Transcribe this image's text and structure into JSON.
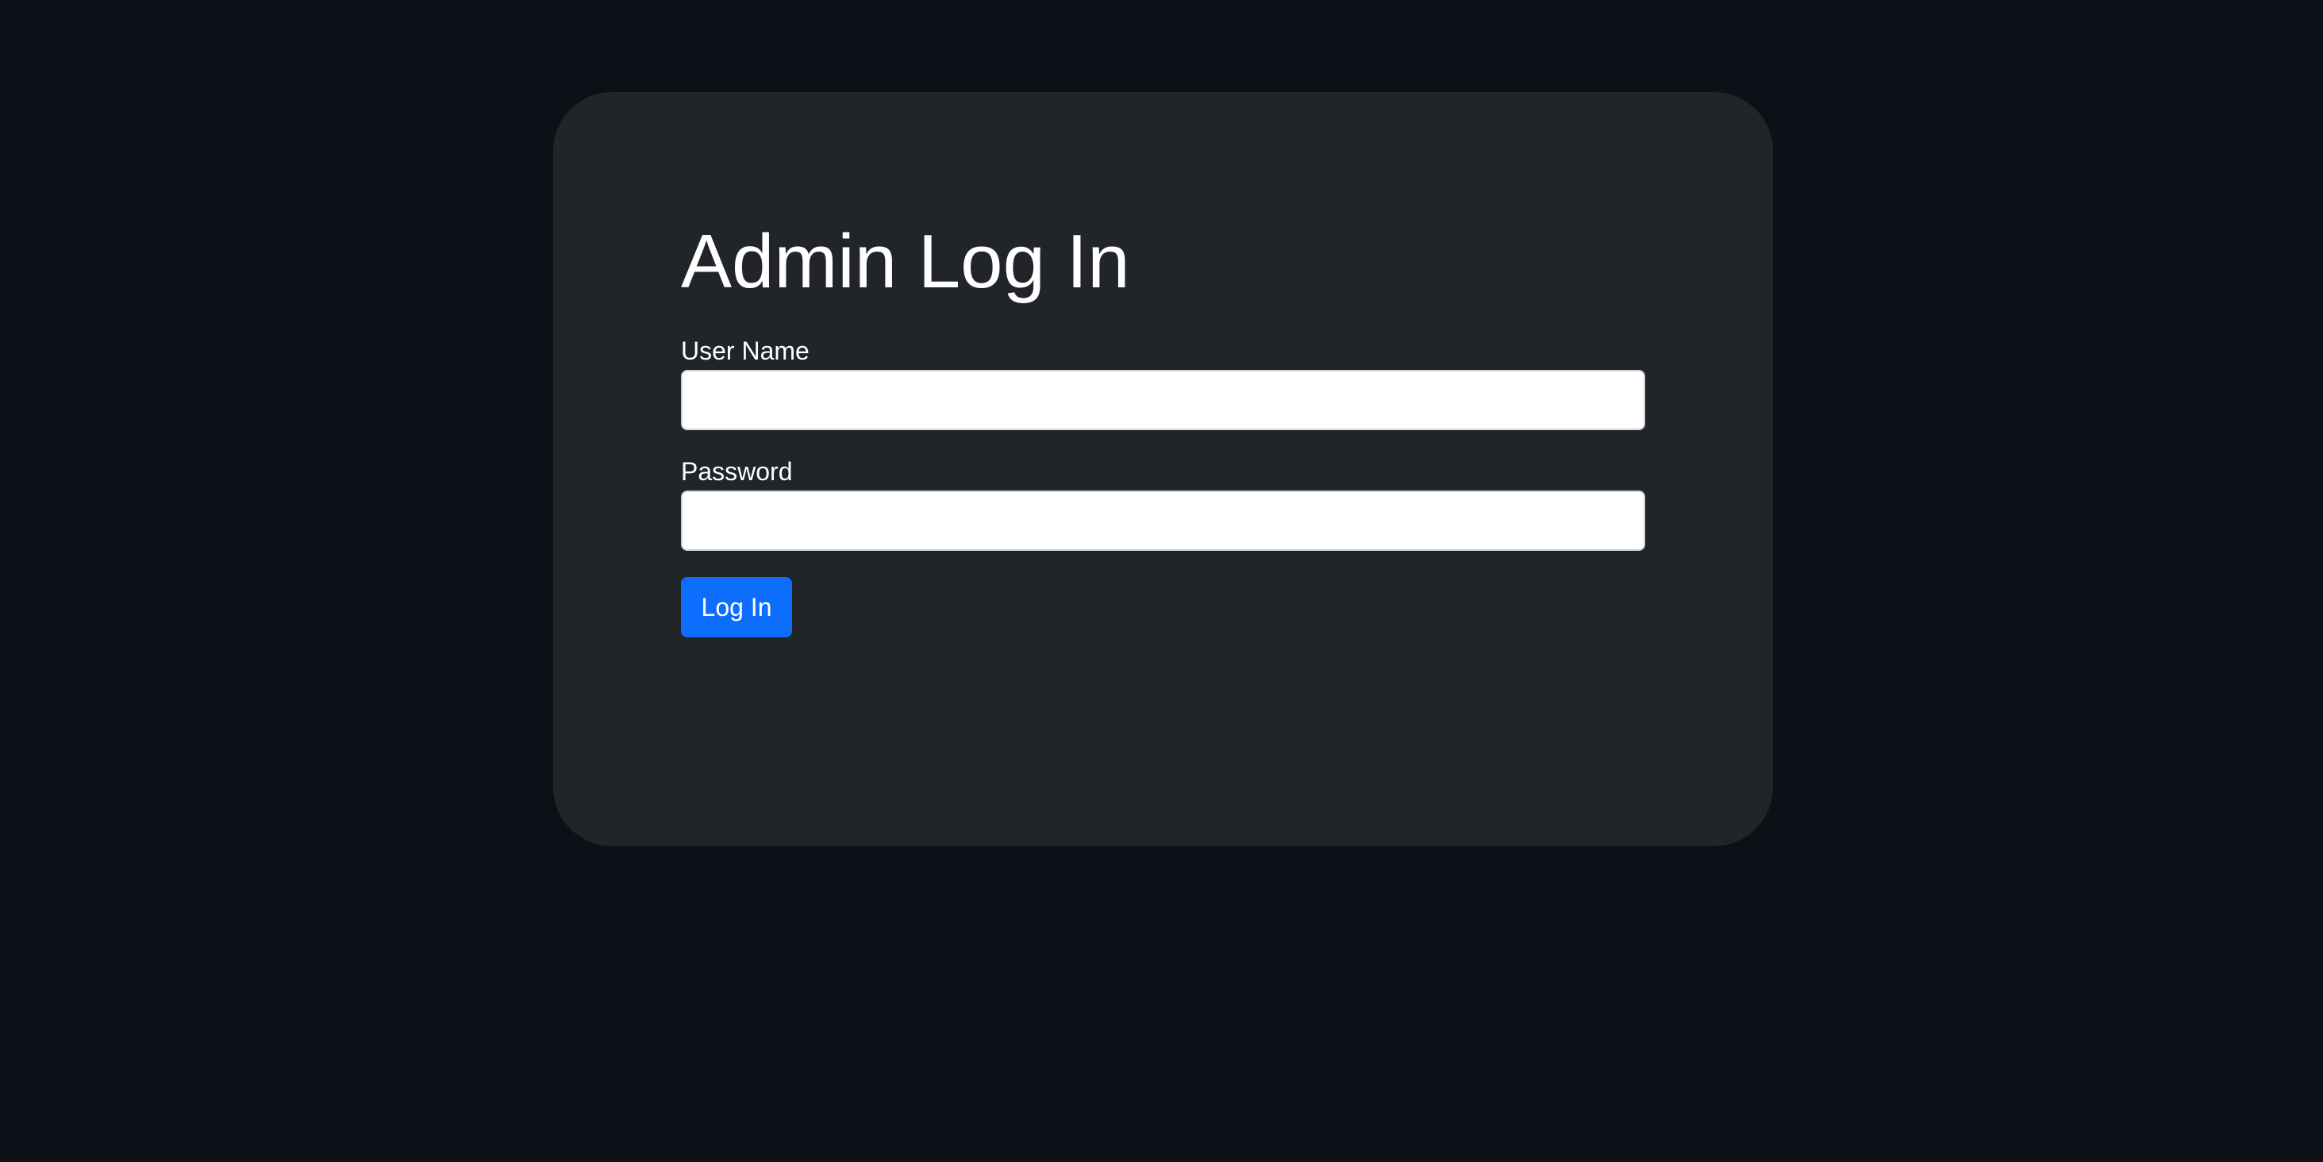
{
  "login_form": {
    "title": "Admin Log In",
    "username_label": "User Name",
    "username_value": "",
    "password_label": "Password",
    "password_value": "",
    "submit_label": "Log In"
  },
  "colors": {
    "page_background": "#0d1117",
    "card_background": "#212429",
    "primary_button": "#0d6efd",
    "text": "#ffffff"
  }
}
